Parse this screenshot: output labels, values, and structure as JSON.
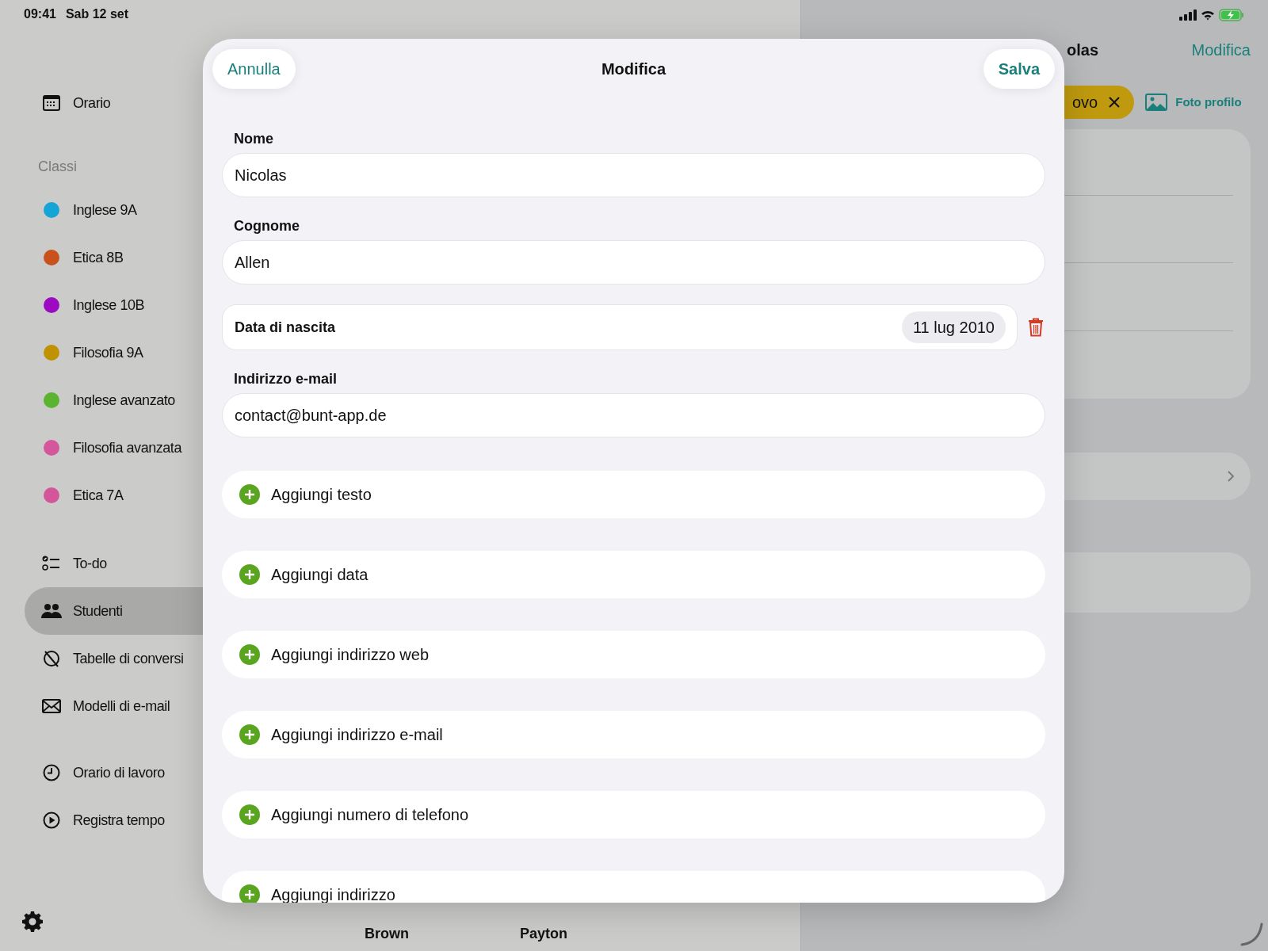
{
  "status_bar": {
    "time": "09:41",
    "date": "Sab 12 set"
  },
  "sidebar": {
    "nav_top": [
      {
        "label": "Orario",
        "kind": "calendar",
        "selected": false
      }
    ],
    "section_title": "Classi",
    "classes": [
      {
        "label": "Inglese 9A",
        "color": "#14a5d6"
      },
      {
        "label": "Etica 8B",
        "color": "#c9511b"
      },
      {
        "label": "Inglese 10B",
        "color": "#9c0bc1"
      },
      {
        "label": "Filosofia 9A",
        "color": "#c19200"
      },
      {
        "label": "Inglese avanzato",
        "color": "#5bb42f"
      },
      {
        "label": "Filosofia avanzata",
        "color": "#d4569b"
      },
      {
        "label": "Etica 7A",
        "color": "#d4569a"
      }
    ],
    "nav_middle": [
      {
        "label": "To-do",
        "kind": "checklist",
        "selected": false
      },
      {
        "label": "Studenti",
        "kind": "people",
        "selected": true
      },
      {
        "label": "Tabelle di conversi",
        "kind": "slashed",
        "selected": false
      },
      {
        "label": "Modelli di e-mail",
        "kind": "envelope",
        "selected": false
      }
    ],
    "nav_bottom": [
      {
        "label": "Orario di lavoro",
        "kind": "clock",
        "selected": false
      },
      {
        "label": "Registra tempo",
        "kind": "play",
        "selected": false
      }
    ]
  },
  "list": {
    "names": [
      "Brown",
      "Payton"
    ]
  },
  "detail": {
    "title": "olas",
    "edit_button": "Modifica",
    "tag": {
      "label": "ovo",
      "color": "#bf9a0e"
    },
    "photo_link": "Foto profilo"
  },
  "modal": {
    "title": "Modifica",
    "cancel": "Annulla",
    "save": "Salva",
    "fields": [
      {
        "kind": "text",
        "label": "Nome",
        "value": "Nicolas"
      },
      {
        "kind": "text",
        "label": "Cognome",
        "value": "Allen"
      },
      {
        "kind": "date",
        "label": "Data di nascita",
        "value": "11 lug 2010"
      },
      {
        "kind": "text",
        "label": "Indirizzo e-mail",
        "value": "contact@bunt-app.de"
      }
    ],
    "add_buttons": [
      "Aggiungi testo",
      "Aggiungi data",
      "Aggiungi indirizzo web",
      "Aggiungi indirizzo e-mail",
      "Aggiungi numero di telefono",
      "Aggiungi indirizzo"
    ]
  }
}
